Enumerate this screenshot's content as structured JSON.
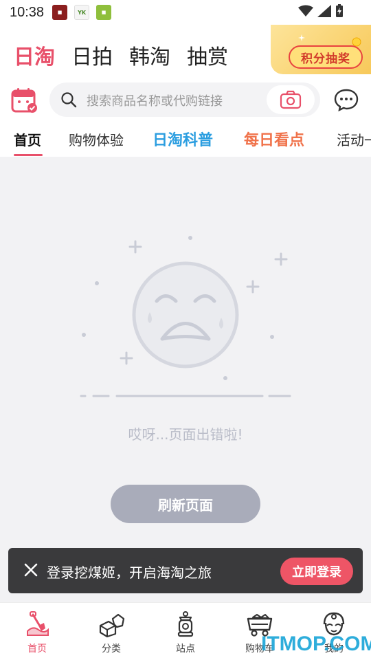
{
  "status_bar": {
    "time": "10:38"
  },
  "top_nav": {
    "items": [
      "日淘",
      "日拍",
      "韩淘",
      "抽赏"
    ]
  },
  "lottery": {
    "label": "积分抽奖"
  },
  "search": {
    "placeholder": "搜索商品名称或代购链接"
  },
  "tabs": [
    "首页",
    "购物体验",
    "日淘科普",
    "每日看点",
    "活动一"
  ],
  "error": {
    "message": "哎呀...页面出错啦!",
    "refresh_label": "刷新页面"
  },
  "toast": {
    "message": "登录挖煤姬，开启海淘之旅",
    "login_label": "立即登录"
  },
  "bottom_nav": {
    "items": [
      "首页",
      "分类",
      "站点",
      "购物车",
      "我的"
    ]
  },
  "watermark": "ITMOP.COM",
  "colors": {
    "accent": "#e8506a",
    "blue_tab": "#2c9ee0",
    "orange_tab": "#f0724a"
  }
}
